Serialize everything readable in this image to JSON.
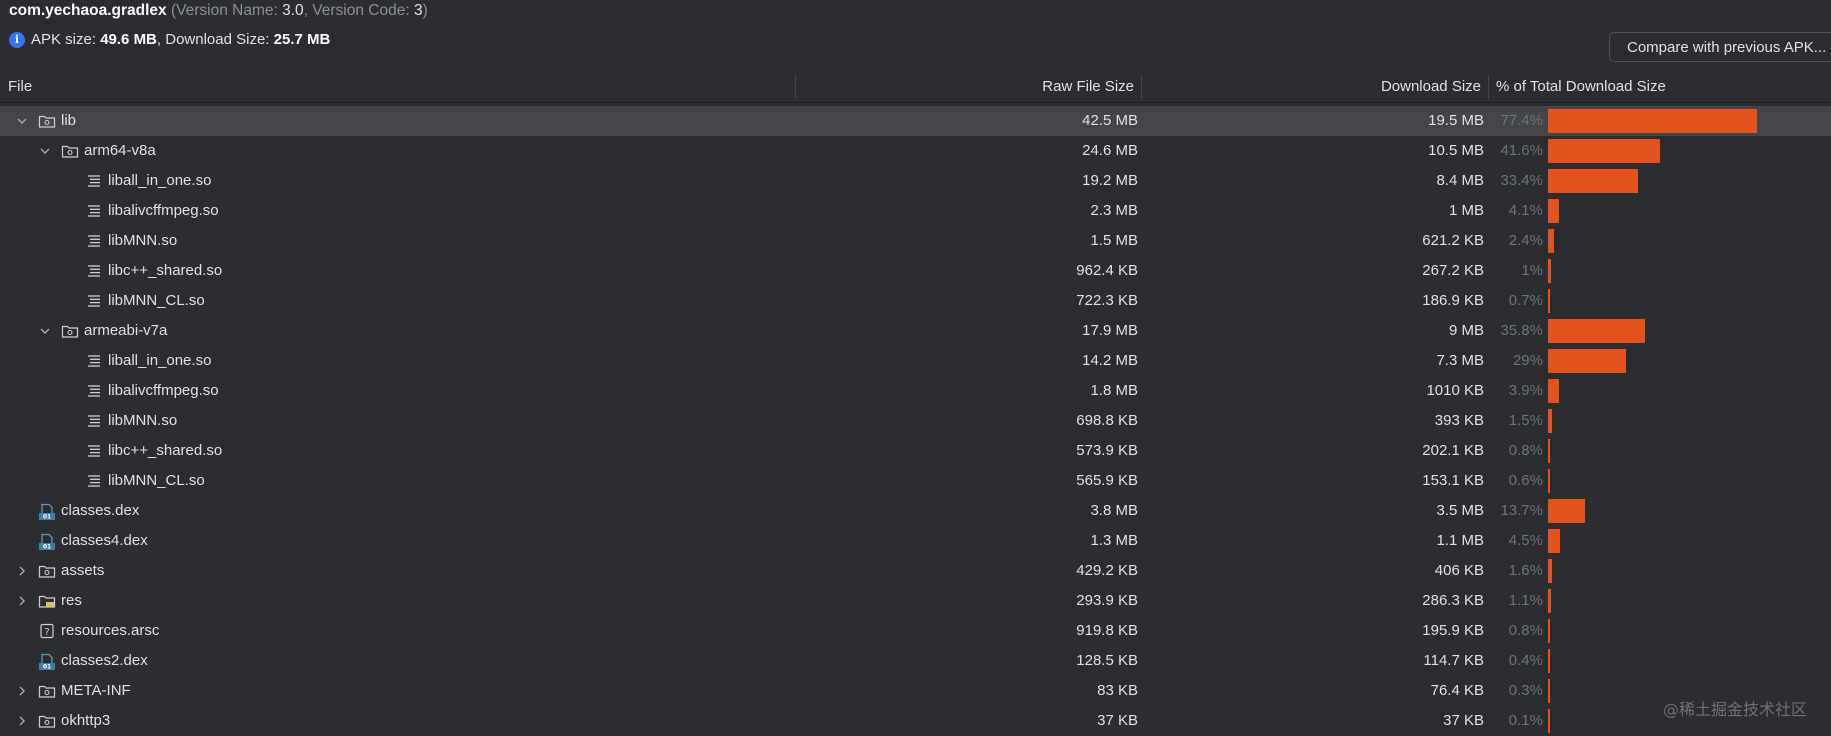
{
  "header": {
    "package": "com.yechaoa.gradlex",
    "version_prefix": " (Version Name: ",
    "version_name": "3.0",
    "version_mid": ", Version Code: ",
    "version_code": "3",
    "version_suffix": ")",
    "apk_size_label": "APK size: ",
    "apk_size_value": "49.6 MB",
    "download_size_label": ", Download Size: ",
    "download_size_value": "25.7 MB",
    "compare_button": "Compare with previous APK..."
  },
  "columns": {
    "file": "File",
    "raw": "Raw File Size",
    "download": "Download Size",
    "percent": "% of Total Download Size"
  },
  "colors": {
    "bar": "#e3541c",
    "selected_row": "#43454a",
    "background": "#2b2d30"
  },
  "rows": [
    {
      "name": "lib",
      "raw": "42.5 MB",
      "download": "19.5 MB",
      "percent": "77.4%",
      "pct_value": 77.4,
      "depth": 0,
      "expander": "expanded",
      "icon": "folder-icon",
      "selected": true
    },
    {
      "name": "arm64-v8a",
      "raw": "24.6 MB",
      "download": "10.5 MB",
      "percent": "41.6%",
      "pct_value": 41.6,
      "depth": 1,
      "expander": "expanded",
      "icon": "folder-icon"
    },
    {
      "name": "liball_in_one.so",
      "raw": "19.2 MB",
      "download": "8.4 MB",
      "percent": "33.4%",
      "pct_value": 33.4,
      "depth": 2,
      "expander": "none",
      "icon": "file-lines-icon"
    },
    {
      "name": "libalivcffmpeg.so",
      "raw": "2.3 MB",
      "download": "1 MB",
      "percent": "4.1%",
      "pct_value": 4.1,
      "depth": 2,
      "expander": "none",
      "icon": "file-lines-icon"
    },
    {
      "name": "libMNN.so",
      "raw": "1.5 MB",
      "download": "621.2 KB",
      "percent": "2.4%",
      "pct_value": 2.4,
      "depth": 2,
      "expander": "none",
      "icon": "file-lines-icon"
    },
    {
      "name": "libc++_shared.so",
      "raw": "962.4 KB",
      "download": "267.2 KB",
      "percent": "1%",
      "pct_value": 1.0,
      "depth": 2,
      "expander": "none",
      "icon": "file-lines-icon"
    },
    {
      "name": "libMNN_CL.so",
      "raw": "722.3 KB",
      "download": "186.9 KB",
      "percent": "0.7%",
      "pct_value": 0.7,
      "depth": 2,
      "expander": "none",
      "icon": "file-lines-icon"
    },
    {
      "name": "armeabi-v7a",
      "raw": "17.9 MB",
      "download": "9 MB",
      "percent": "35.8%",
      "pct_value": 35.8,
      "depth": 1,
      "expander": "expanded",
      "icon": "folder-icon"
    },
    {
      "name": "liball_in_one.so",
      "raw": "14.2 MB",
      "download": "7.3 MB",
      "percent": "29%",
      "pct_value": 29.0,
      "depth": 2,
      "expander": "none",
      "icon": "file-lines-icon"
    },
    {
      "name": "libalivcffmpeg.so",
      "raw": "1.8 MB",
      "download": "1010 KB",
      "percent": "3.9%",
      "pct_value": 3.9,
      "depth": 2,
      "expander": "none",
      "icon": "file-lines-icon"
    },
    {
      "name": "libMNN.so",
      "raw": "698.8 KB",
      "download": "393 KB",
      "percent": "1.5%",
      "pct_value": 1.5,
      "depth": 2,
      "expander": "none",
      "icon": "file-lines-icon"
    },
    {
      "name": "libc++_shared.so",
      "raw": "573.9 KB",
      "download": "202.1 KB",
      "percent": "0.8%",
      "pct_value": 0.8,
      "depth": 2,
      "expander": "none",
      "icon": "file-lines-icon"
    },
    {
      "name": "libMNN_CL.so",
      "raw": "565.9 KB",
      "download": "153.1 KB",
      "percent": "0.6%",
      "pct_value": 0.6,
      "depth": 2,
      "expander": "none",
      "icon": "file-lines-icon"
    },
    {
      "name": "classes.dex",
      "raw": "3.8 MB",
      "download": "3.5 MB",
      "percent": "13.7%",
      "pct_value": 13.7,
      "depth": 0,
      "expander": "none",
      "icon": "dex-file-icon"
    },
    {
      "name": "classes4.dex",
      "raw": "1.3 MB",
      "download": "1.1 MB",
      "percent": "4.5%",
      "pct_value": 4.5,
      "depth": 0,
      "expander": "none",
      "icon": "dex-file-icon"
    },
    {
      "name": "assets",
      "raw": "429.2 KB",
      "download": "406 KB",
      "percent": "1.6%",
      "pct_value": 1.6,
      "depth": 0,
      "expander": "collapsed",
      "icon": "folder-icon"
    },
    {
      "name": "res",
      "raw": "293.9 KB",
      "download": "286.3 KB",
      "percent": "1.1%",
      "pct_value": 1.1,
      "depth": 0,
      "expander": "collapsed",
      "icon": "resource-folder-icon"
    },
    {
      "name": "resources.arsc",
      "raw": "919.8 KB",
      "download": "195.9 KB",
      "percent": "0.8%",
      "pct_value": 0.8,
      "depth": 0,
      "expander": "none",
      "icon": "unknown-file-icon"
    },
    {
      "name": "classes2.dex",
      "raw": "128.5 KB",
      "download": "114.7 KB",
      "percent": "0.4%",
      "pct_value": 0.4,
      "depth": 0,
      "expander": "none",
      "icon": "dex-file-icon"
    },
    {
      "name": "META-INF",
      "raw": "83 KB",
      "download": "76.4 KB",
      "percent": "0.3%",
      "pct_value": 0.3,
      "depth": 0,
      "expander": "collapsed",
      "icon": "folder-icon"
    },
    {
      "name": "okhttp3",
      "raw": "37 KB",
      "download": "37 KB",
      "percent": "0.1%",
      "pct_value": 0.1,
      "depth": 0,
      "expander": "collapsed",
      "icon": "folder-icon"
    }
  ],
  "watermark": "@稀土掘金技术社区"
}
